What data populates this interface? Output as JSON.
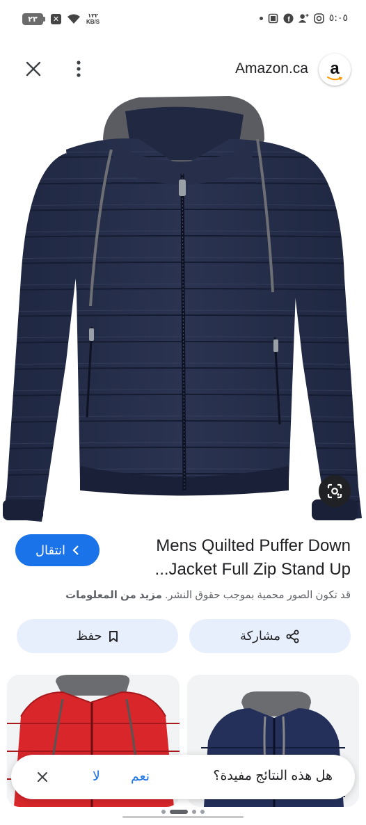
{
  "status_bar": {
    "battery": "٢٣",
    "net_speed_value": "١٢٢",
    "net_speed_unit": "KB/S",
    "clock": "٥:٠٥",
    "icons": [
      "battery-icon",
      "x-app-icon",
      "wifi-icon",
      "dot-icon",
      "gallery-icon",
      "facebook-icon",
      "user-add-icon",
      "instagram-icon"
    ]
  },
  "header": {
    "site_title": "Amazon.ca",
    "logo_letter": "a",
    "icons": [
      "close-icon",
      "more-vertical-icon"
    ]
  },
  "result": {
    "title_line1": "Mens Quilted Puffer Down",
    "title_line2": "...Jacket Full Zip Stand Up",
    "visit_label": "انتقال",
    "copyright_note": "قد تكون الصور محمية بموجب حقوق النشر.",
    "more_info": "مزيد من المعلومات"
  },
  "actions": {
    "share_label": "مشاركة",
    "save_label": "حفظ"
  },
  "feedback": {
    "question": "هل هذه النتائج مفيدة؟",
    "yes_label": "نعم",
    "no_label": "لا"
  },
  "colors": {
    "accent": "#1a73e8",
    "action_bg": "#e8effc",
    "jacket_navy": "#232c45"
  }
}
